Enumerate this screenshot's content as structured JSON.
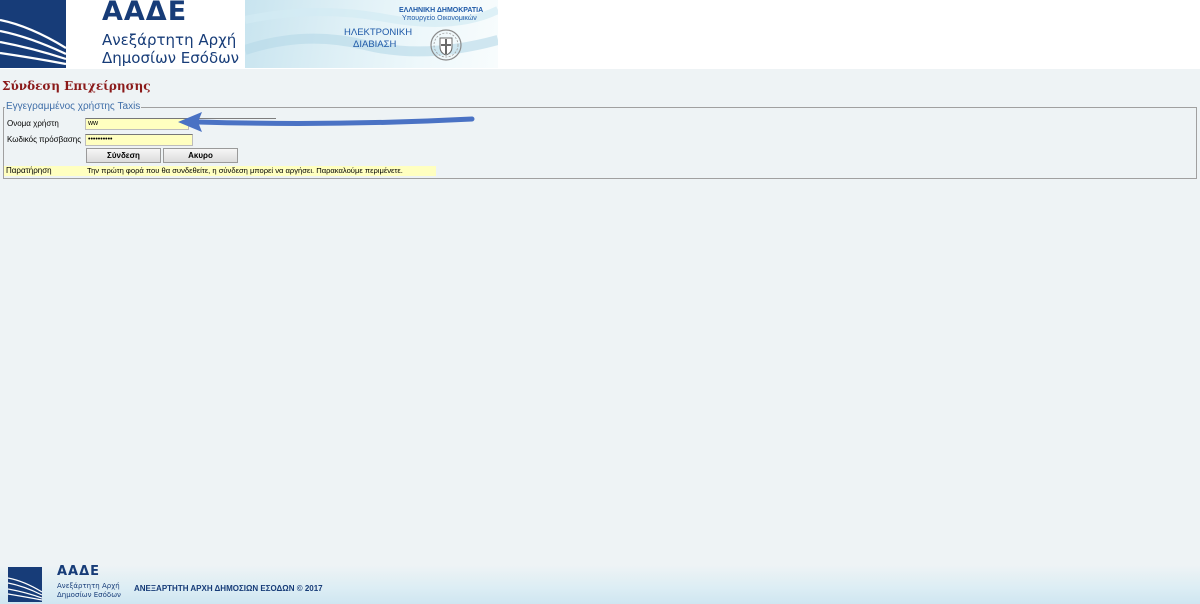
{
  "header": {
    "logo": {
      "title": "ΑΑΔΕ",
      "subtitle_line1": "Ανεξάρτητη Αρχή",
      "subtitle_line2": "Δημοσίων Εσόδων",
      "icon": "aade-logo-mark"
    },
    "gov_banner": {
      "republic": "ΕΛΛΗΝΙΚΗ ΔΗΜΟΚΡΑΤΙΑ",
      "ministry": "Υπουργείο Οικονομικών",
      "service_line1": "ΗΛΕΚΤΡΟΝΙΚΗ",
      "service_line2": "ΔΙΑΒΙΑΣΗ",
      "icon": "greek-state-emblem"
    }
  },
  "page": {
    "title": "Σύνδεση Επιχείρησης"
  },
  "login": {
    "legend": "Εγγεγραμμένος χρήστης Taxis",
    "username_label": "Ονομα χρήστη",
    "username_value": "ww",
    "password_label": "Κωδικός πρόσβασης",
    "password_value": "••••••••••",
    "login_button": "Σύνδεση",
    "cancel_button": "Ακυρο",
    "note_label": "Παρατήρηση",
    "note_text": "Την πρώτη φορά που θα συνδεθείτε, η σύνδεση μπορεί να αργήσει. Παρακαλούμε περιμένετε."
  },
  "annotation": {
    "icon": "arrow-left",
    "color": "#4a72c4"
  },
  "footer": {
    "logo_title": "ΑΑΔΕ",
    "logo_subtitle_line1": "Ανεξάρτητη Αρχή",
    "logo_subtitle_line2": "Δημοσίων Εσόδων",
    "copyright": "ΑΝΕΞΑΡΤΗΤΗ ΑΡΧΗ ΔΗΜΟΣΙΩΝ ΕΣΟΔΩΝ © 2017"
  },
  "colors": {
    "brand_blue": "#173c78",
    "title_red": "#8b1a1a",
    "input_yellow": "#ffffc0",
    "page_bg": "#eef3f5"
  }
}
